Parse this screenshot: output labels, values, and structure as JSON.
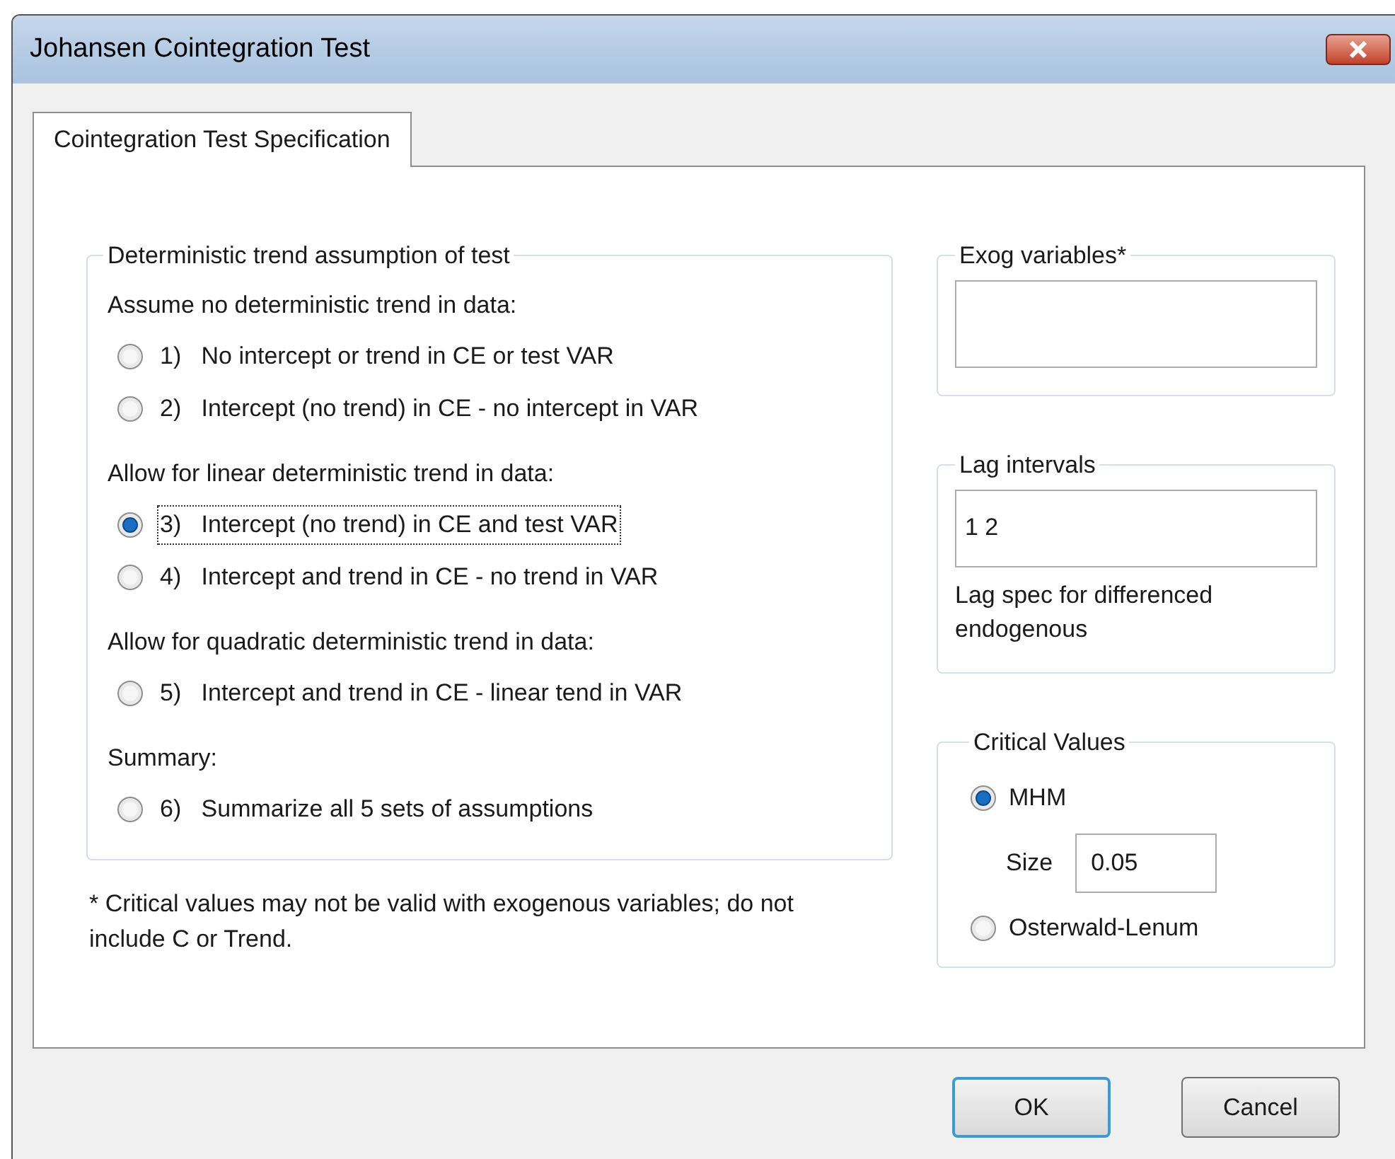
{
  "window": {
    "title": "Johansen Cointegration Test"
  },
  "tabs": [
    {
      "label": "Cointegration Test Specification",
      "selected": true
    }
  ],
  "trend_group": {
    "title": "Deterministic trend assumption of test",
    "sections": [
      {
        "heading": "Assume no deterministic trend in data:",
        "options": [
          {
            "label": "1)   No intercept or trend in CE or test VAR",
            "selected": false,
            "focused": false
          },
          {
            "label": "2)   Intercept (no trend) in CE - no intercept in VAR",
            "selected": false,
            "focused": false
          }
        ]
      },
      {
        "heading": "Allow for linear deterministic trend in data:",
        "options": [
          {
            "label": "3)   Intercept (no trend) in CE and test VAR",
            "selected": true,
            "focused": true
          },
          {
            "label": "4)   Intercept and trend in CE - no trend in VAR",
            "selected": false,
            "focused": false
          }
        ]
      },
      {
        "heading": "Allow for quadratic deterministic trend in data:",
        "options": [
          {
            "label": "5)   Intercept and trend in CE - linear tend in VAR",
            "selected": false,
            "focused": false
          }
        ]
      },
      {
        "heading": "Summary:",
        "options": [
          {
            "label": "6)   Summarize all 5 sets of assumptions",
            "selected": false,
            "focused": false
          }
        ]
      }
    ]
  },
  "footnote": "* Critical values may not be valid with exogenous variables; do not include C or Trend.",
  "exog": {
    "title": "Exog variables*"
  },
  "lag": {
    "title": "Lag intervals",
    "value": "1 2",
    "note": "Lag spec for differenced endogenous"
  },
  "critical_values": {
    "title": "Critical Values",
    "options": [
      {
        "label": "MHM",
        "selected": true
      },
      {
        "label": "Osterwald-Lenum",
        "selected": false
      }
    ],
    "size": {
      "label": "Size",
      "value": "0.05"
    }
  },
  "buttons": [
    {
      "label": "OK",
      "default": true
    },
    {
      "label": "Cancel",
      "default": false
    }
  ]
}
